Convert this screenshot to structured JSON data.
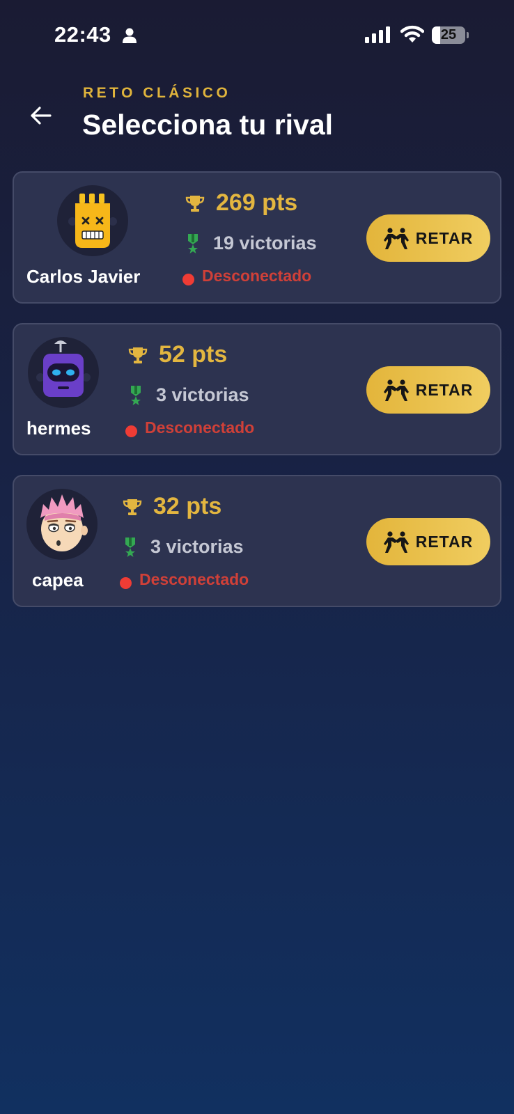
{
  "status_bar": {
    "time": "22:43",
    "battery": "25"
  },
  "header": {
    "subtitle": "RETO CLÁSICO",
    "title": "Selecciona tu rival"
  },
  "rivals": [
    {
      "name": "Carlos Javier",
      "points": "269 pts",
      "wins": "19 victorias",
      "status": "Desconectado",
      "button": "RETAR",
      "avatar": "robot-yellow-avatar"
    },
    {
      "name": "hermes",
      "points": "52 pts",
      "wins": "3 victorias",
      "status": "Desconectado",
      "button": "RETAR",
      "avatar": "robot-purple-avatar"
    },
    {
      "name": "capea",
      "points": "32 pts",
      "wins": "3 victorias",
      "status": "Desconectado",
      "button": "RETAR",
      "avatar": "pink-hair-boy-avatar"
    }
  ],
  "colors": {
    "accent": "#e3b640",
    "offline": "#ef3c35",
    "card": "#2d3350",
    "wins_icon": "#34a853"
  },
  "icons": {
    "back": "arrow-left-icon",
    "points": "trophy-icon",
    "wins": "medal-icon",
    "challenge": "wrestling-icon",
    "user": "person-icon"
  }
}
